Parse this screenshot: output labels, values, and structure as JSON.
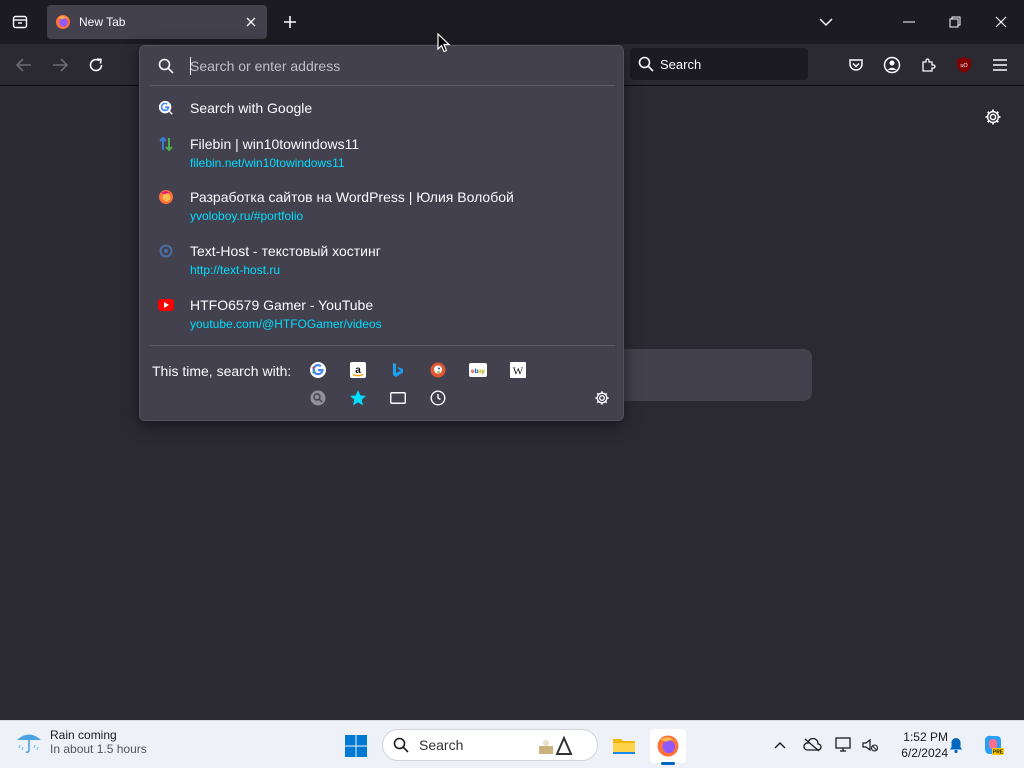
{
  "tab": {
    "title": "New Tab"
  },
  "toolbar": {
    "search_label": "Search"
  },
  "urlbar": {
    "placeholder": "Search or enter address",
    "results": [
      {
        "title": "Search with Google",
        "url": "",
        "icon": "google-search-icon"
      },
      {
        "title": "Filebin | win10towindows11",
        "url": "filebin.net/win10towindows11",
        "icon": "filebin-icon"
      },
      {
        "title": "Разработка сайтов на WordPress | Юлия Волобой",
        "url": "yvoloboy.ru/#portfolio",
        "icon": "firefox-site-icon"
      },
      {
        "title": "Text-Host - текстовый хостинг",
        "url": "http://text-host.ru",
        "icon": "texthost-icon"
      },
      {
        "title": "HTFO6579 Gamer - YouTube",
        "url": "youtube.com/@HTFOGamer/videos",
        "icon": "youtube-icon"
      }
    ],
    "oneoff_label": "This time, search with:",
    "engines": [
      "Google",
      "Amazon",
      "Bing",
      "DuckDuckGo",
      "eBay",
      "Wikipedia"
    ],
    "modes": [
      "search-engines",
      "bookmarks",
      "tabs",
      "history"
    ]
  },
  "taskbar": {
    "weather_title": "Rain coming",
    "weather_sub": "In about 1.5 hours",
    "search_label": "Search",
    "time": "1:52 PM",
    "date": "6/2/2024"
  },
  "colors": {
    "chrome_bg": "#1c1b22",
    "toolbar_bg": "#2b2a33",
    "panel_bg": "#42414d",
    "url_link": "#00ddff",
    "taskbar_bg": "#eef2f8"
  }
}
